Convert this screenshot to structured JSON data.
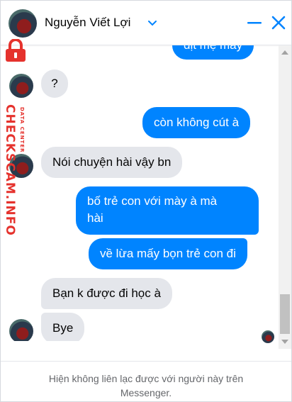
{
  "header": {
    "contact_name": "Nguyễn Viết Lợi"
  },
  "messages": [
    {
      "direction": "out",
      "text": "địt mẹ mày"
    },
    {
      "direction": "in",
      "text": "?"
    },
    {
      "direction": "out",
      "text": "còn không cút à"
    },
    {
      "direction": "in",
      "text": "Nói chuyện hài vậy bn"
    },
    {
      "direction": "out",
      "lines": [
        "bố trẻ con với mày à mà",
        "hài"
      ]
    },
    {
      "direction": "out",
      "text": "về lừa mấy bọn trẻ con đi"
    },
    {
      "direction": "in",
      "text": "Bạn k  được đi học à"
    },
    {
      "direction": "in",
      "text": "Bye"
    }
  ],
  "footer": {
    "line1": "Hiện không liên lạc được với người này trên",
    "line2": "Messenger."
  },
  "watermark": {
    "brand": "CHECKSCAM.INFO",
    "sub": "DATA CENTER"
  },
  "colors": {
    "outgoing_bubble": "#0084ff",
    "incoming_bubble": "#e4e6eb",
    "accent": "#0084ff",
    "watermark": "#e5322d"
  },
  "icons": [
    "chevron-down-icon",
    "minimize-icon",
    "close-icon",
    "lock-icon"
  ]
}
